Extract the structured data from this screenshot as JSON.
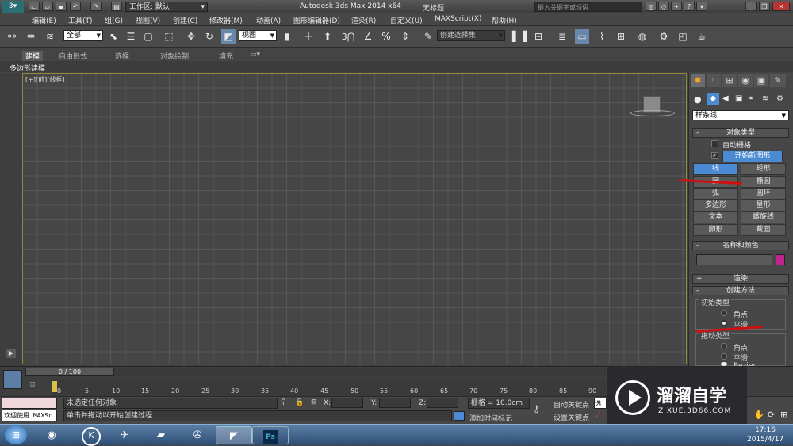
{
  "titlebar": {
    "workspace_label": "工作区: 默认",
    "app_title": "Autodesk 3ds Max  2014 x64",
    "doc_title": "无标题",
    "search_placeholder": "键入关键字或短语"
  },
  "menu": [
    "编辑(E)",
    "工具(T)",
    "组(G)",
    "视图(V)",
    "创建(C)",
    "修改器(M)",
    "动画(A)",
    "图形编辑器(D)",
    "渲染(R)",
    "自定义(U)",
    "MAXScript(X)",
    "帮助(H)"
  ],
  "toolbar": {
    "filter_value": "全部",
    "refcoord_value": "视图",
    "num_3": "3",
    "percent": "%",
    "selset_value": "创建选择集"
  },
  "ribbon": {
    "tabs": [
      "建模",
      "自由形式",
      "选择",
      "对象绘制",
      "填充"
    ],
    "subtab": "多边形建模"
  },
  "viewport": {
    "label_plus": "[+]",
    "label_view": "[前]",
    "label_mode": "[线框]"
  },
  "command_panel": {
    "category_value": "样条线",
    "object_type_title": "对象类型",
    "autogrid_label": "自动栅格",
    "start_new_shape_label": "开始新图形",
    "buttons": [
      "线",
      "矩形",
      "圆",
      "椭圆",
      "弧",
      "圆环",
      "多边形",
      "星形",
      "文本",
      "螺旋线",
      "卵形",
      "截面"
    ],
    "active_button": "线",
    "name_color_title": "名称和颜色",
    "name_value": "",
    "swatch_color": "#c0238a",
    "render_title": "渲染",
    "creation_method_title": "创建方法",
    "initial_type_title": "初始类型",
    "initial_options": [
      "角点",
      "平滑"
    ],
    "drag_type_title": "拖动类型",
    "drag_options": [
      "角点",
      "平滑",
      "Bezier"
    ],
    "plus": "+",
    "minus": "-"
  },
  "timeline": {
    "frame_display": "0 / 100",
    "ticks": [
      "0",
      "5",
      "10",
      "15",
      "20",
      "25",
      "30",
      "35",
      "40",
      "45",
      "50",
      "55",
      "60",
      "65",
      "70",
      "75",
      "80",
      "85",
      "90"
    ],
    "maxscript_label": "欢迎使用 MAXSc"
  },
  "status": {
    "selection_text": "未选定任何对象",
    "prompt_text": "单击并拖动以开始创建过程",
    "x_label": "X:",
    "y_label": "Y:",
    "z_label": "Z:",
    "grid_text": "栅格 = 10.0cm",
    "autokey_label": "自动关键点",
    "setkey_label": "设置关键点",
    "add_time_tag": "添加时间标记",
    "selected_value": "选定"
  },
  "watermark": {
    "brand": "溜溜自学",
    "url": "ZIXUE.3D66.COM"
  },
  "taskbar": {
    "time": "17:16",
    "date": "2015/4/17"
  },
  "colors": {
    "accent_blue": "#4a8bd4",
    "annotation_red": "#d01010",
    "viewport_border": "#8f8a3a"
  }
}
